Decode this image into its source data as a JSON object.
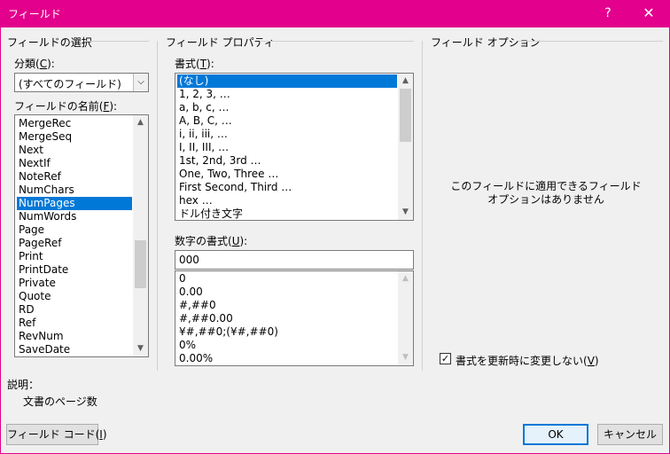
{
  "window": {
    "title": "フィールド",
    "help": "?",
    "close": "✕"
  },
  "select_field": {
    "group_title": "フィールドの選択",
    "category": {
      "label_pre": "分類(",
      "accel": "C",
      "label_post": "):",
      "value": "(すべてのフィールド)"
    },
    "names": {
      "label_pre": "フィールドの名前(",
      "accel": "F",
      "label_post": "):",
      "items": [
        "MergeRec",
        "MergeSeq",
        "Next",
        "NextIf",
        "NoteRef",
        "NumChars",
        "NumPages",
        "NumWords",
        "Page",
        "PageRef",
        "Print",
        "PrintDate",
        "Private",
        "Quote",
        "RD",
        "Ref",
        "RevNum",
        "SaveDate"
      ],
      "selected": "NumPages"
    }
  },
  "properties": {
    "group_title": "フィールド プロパティ",
    "format": {
      "label_pre": "書式(",
      "accel": "T",
      "label_post": "):",
      "items": [
        "(なし)",
        "1, 2, 3, …",
        "a, b, c, …",
        "A, B, C, …",
        "i, ii, iii, …",
        "I, II, III, …",
        "1st, 2nd, 3rd …",
        "One, Two, Three …",
        "First Second, Third …",
        "hex …",
        "ドル付き文字"
      ],
      "selected": "(なし)"
    },
    "number_format": {
      "label_pre": "数字の書式(",
      "accel": "U",
      "label_post": "):",
      "value": "000",
      "items": [
        "0",
        "0.00",
        "#,##0",
        "#,##0.00",
        "¥#,##0;(¥#,##0)",
        "0%",
        "0.00%"
      ]
    }
  },
  "options": {
    "group_title": "フィールド オプション",
    "message_line1": "このフィールドに適用できるフィールド",
    "message_line2": "オプションはありません",
    "preserve_format": {
      "label_pre": "書式を更新時に変更しない(",
      "accel": "V",
      "label_post": ")",
      "checked": true,
      "check_glyph": "✓"
    }
  },
  "description": {
    "label": "説明：",
    "text": "文書のページ数"
  },
  "buttons": {
    "field_codes": {
      "pre": "フィールド コード(",
      "accel": "I",
      "post": ")"
    },
    "ok": "OK",
    "cancel": "キャンセル"
  },
  "icons": {
    "chevron_down": "⌵",
    "scroll_up": "▲",
    "scroll_down": "▼"
  }
}
